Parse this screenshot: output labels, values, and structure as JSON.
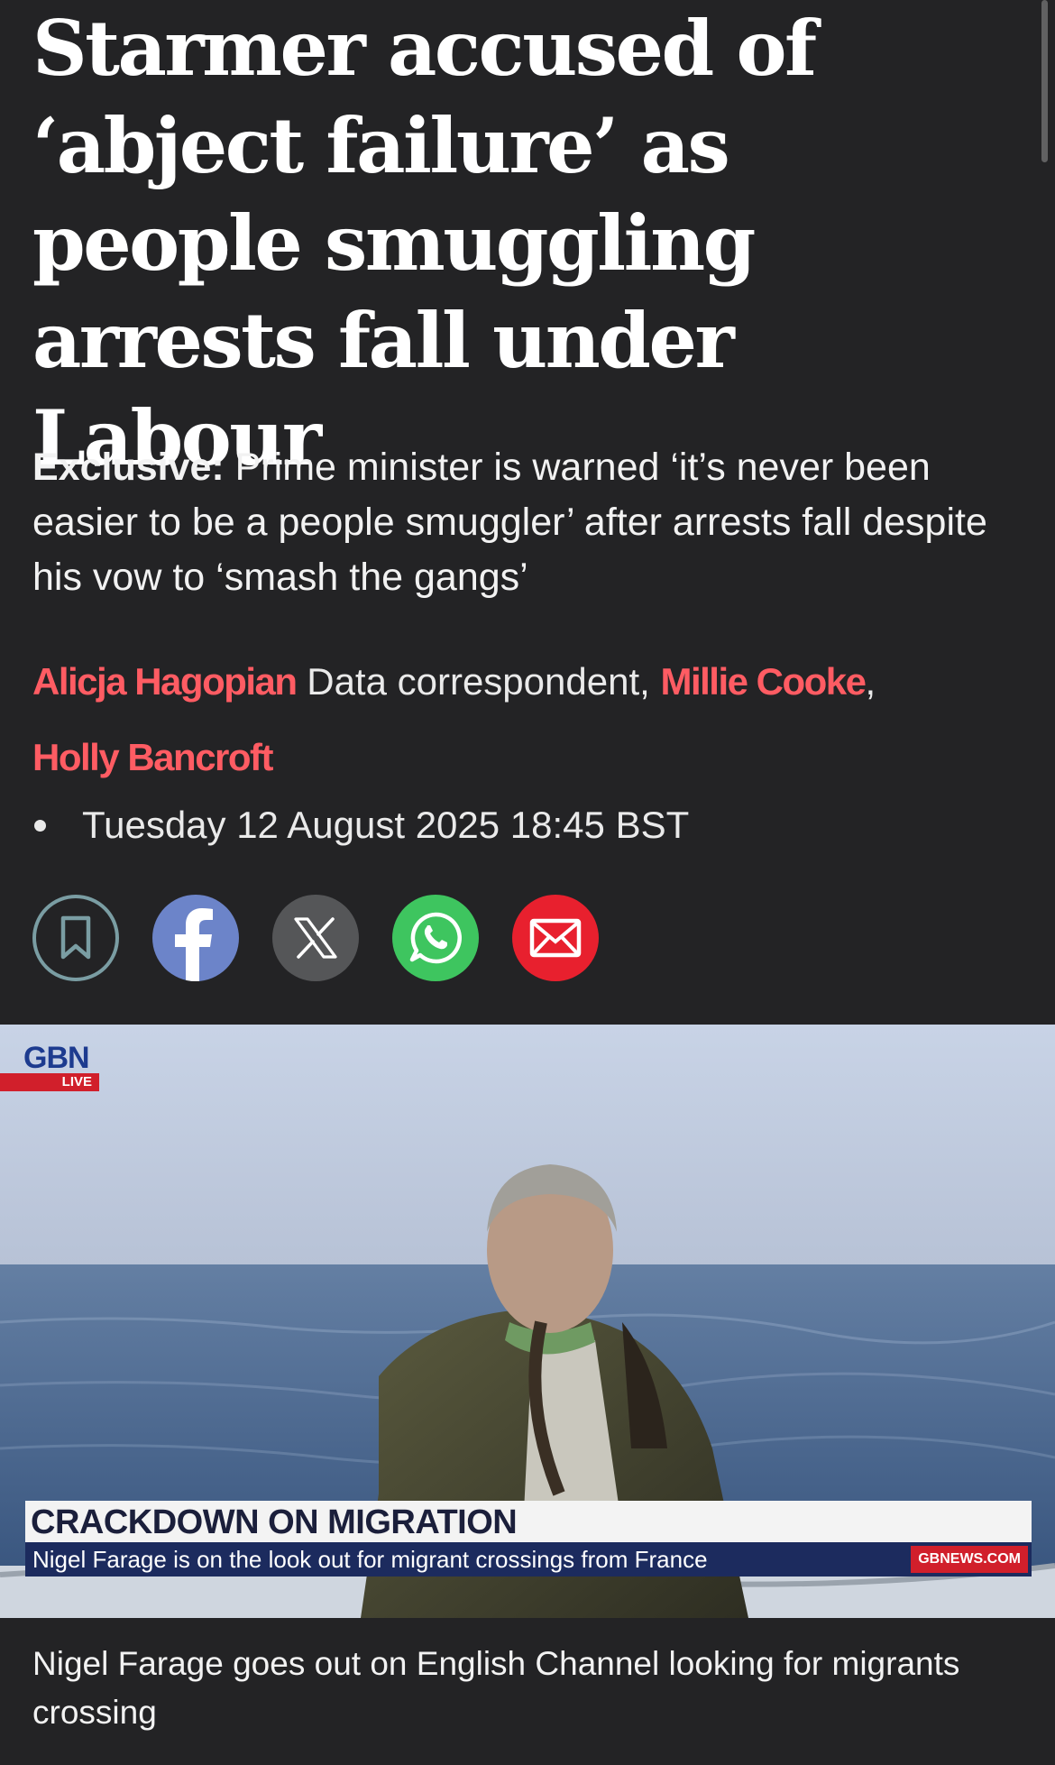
{
  "article": {
    "headline": "Starmer accused of ‘abject failure’ as people smuggling arrests fall under Labour",
    "standfirst": {
      "tag": "Exclusive:",
      "text": " Prime minister is warned ‘it’s never been easier to be a people smuggler’ after arrests fall despite his vow to ‘smash the gangs’"
    },
    "byline": {
      "authors": [
        {
          "name": "Alicja Hagopian",
          "role": " Data correspondent,"
        },
        {
          "name": "Millie Cooke",
          "role": ","
        },
        {
          "name": "Holly Bancroft",
          "role": ""
        }
      ]
    },
    "date": "Tuesday 12 August 2025 18:45 BST"
  },
  "share_buttons": [
    {
      "icon": "bookmark-icon",
      "color": "#7a9da3"
    },
    {
      "icon": "facebook-icon",
      "color": "#6c84c9"
    },
    {
      "icon": "x-icon",
      "color": "#555658"
    },
    {
      "icon": "whatsapp-icon",
      "color": "#3ec55f"
    },
    {
      "icon": "email-icon",
      "color": "#e8202e"
    }
  ],
  "video": {
    "logo": "GBN",
    "logo_badge": "LIVE",
    "lower_third_headline": "CRACKDOWN ON MIGRATION",
    "lower_third_strap": "Nigel Farage is on the look out for migrant crossings from France",
    "lower_third_site": "GBNEWS.COM",
    "caption": "Nigel Farage goes out on English Channel looking for migrants crossing"
  },
  "colors": {
    "background": "#232325",
    "author_link": "#ff5c63",
    "text": "#ffffff"
  }
}
